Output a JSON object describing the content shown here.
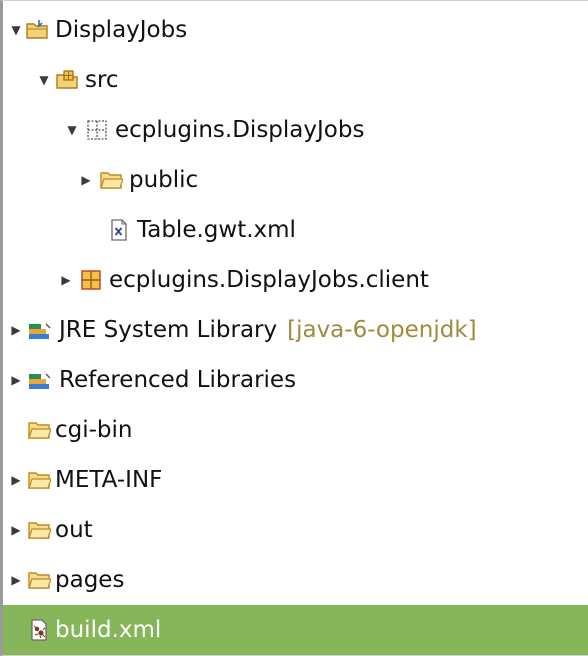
{
  "explorer": {
    "nodes": [
      {
        "name": "DisplayJobs",
        "expanded": true,
        "icon": "project-folder-icon"
      },
      {
        "name": "src",
        "expanded": true,
        "icon": "source-folder-icon"
      },
      {
        "name": "ecplugins.DisplayJobs",
        "expanded": true,
        "icon": "package-icon"
      },
      {
        "name": "public",
        "expanded": false,
        "icon": "folder-icon"
      },
      {
        "name": "Table.gwt.xml",
        "icon": "xml-file-icon"
      },
      {
        "name": "ecplugins.DisplayJobs.client",
        "expanded": false,
        "icon": "package-icon"
      },
      {
        "name": "JRE System Library",
        "decoration": "[java-6-openjdk]",
        "expanded": false,
        "icon": "library-icon"
      },
      {
        "name": "Referenced Libraries",
        "expanded": false,
        "icon": "library-icon"
      },
      {
        "name": "cgi-bin",
        "icon": "folder-icon"
      },
      {
        "name": "META-INF",
        "expanded": false,
        "icon": "folder-icon"
      },
      {
        "name": "out",
        "expanded": false,
        "icon": "folder-icon"
      },
      {
        "name": "pages",
        "expanded": false,
        "icon": "folder-icon"
      },
      {
        "name": "build.xml",
        "selected": true,
        "icon": "ant-build-file-icon"
      }
    ],
    "twisty_expanded": "▼",
    "twisty_collapsed": "▶",
    "colors": {
      "selection": "#86b55a",
      "folder": "#e8a838",
      "decoration": "#a08a3c"
    }
  }
}
